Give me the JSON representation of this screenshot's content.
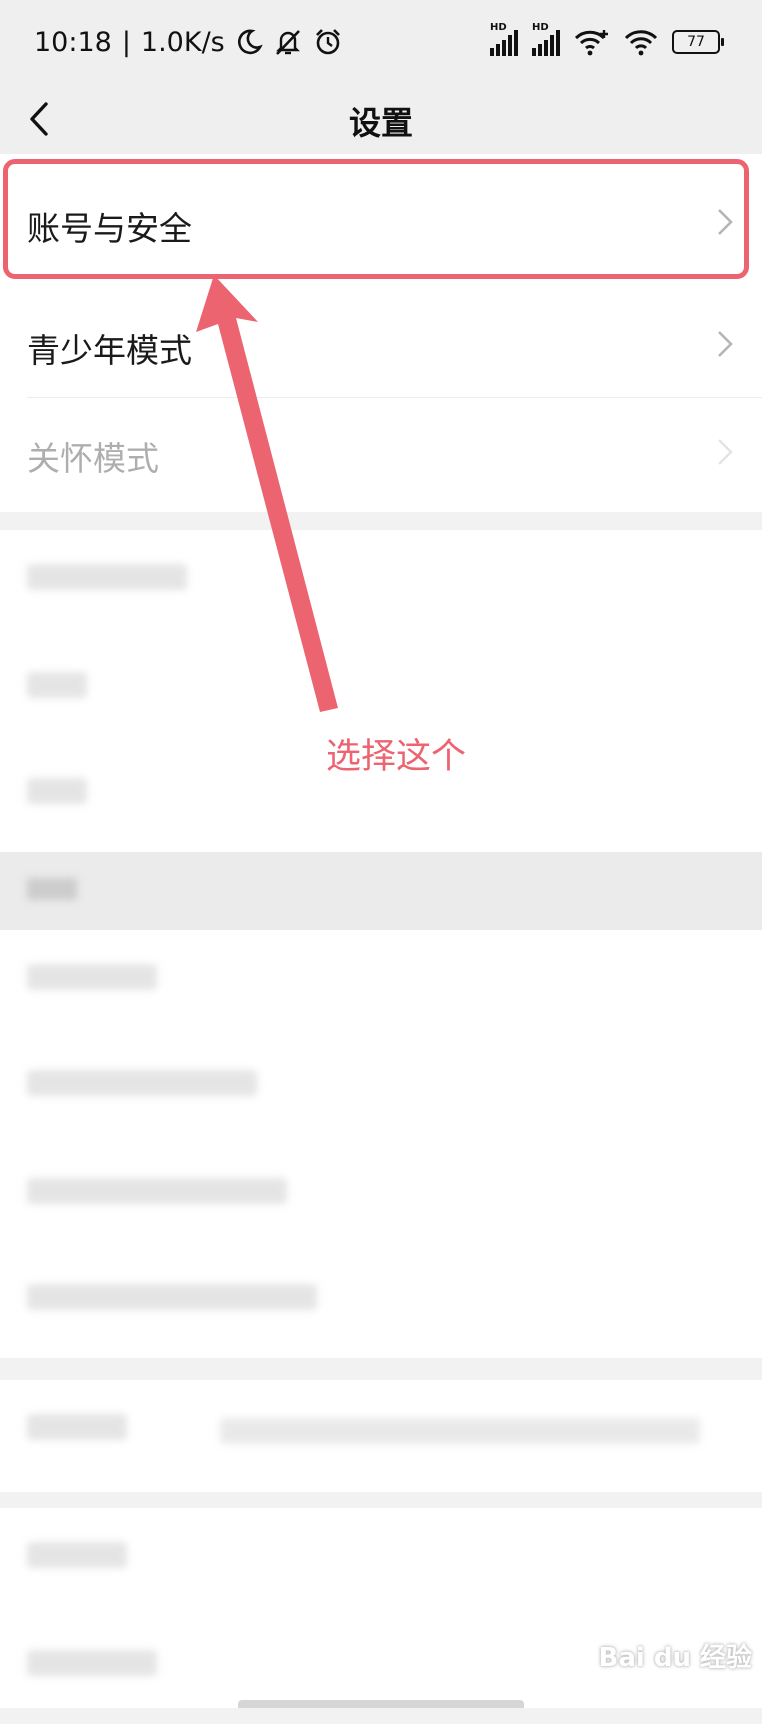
{
  "status_bar": {
    "time": "10:18",
    "speed": "1.0K/s",
    "battery": "77",
    "signal_label": "HD"
  },
  "header": {
    "title": "设置"
  },
  "group1": [
    {
      "label": "账号与安全"
    },
    {
      "label": "青少年模式"
    },
    {
      "label": "关怀模式"
    }
  ],
  "annotation": {
    "text": "选择这个",
    "color": "#ec6470"
  },
  "watermark": "Bai du 经验"
}
